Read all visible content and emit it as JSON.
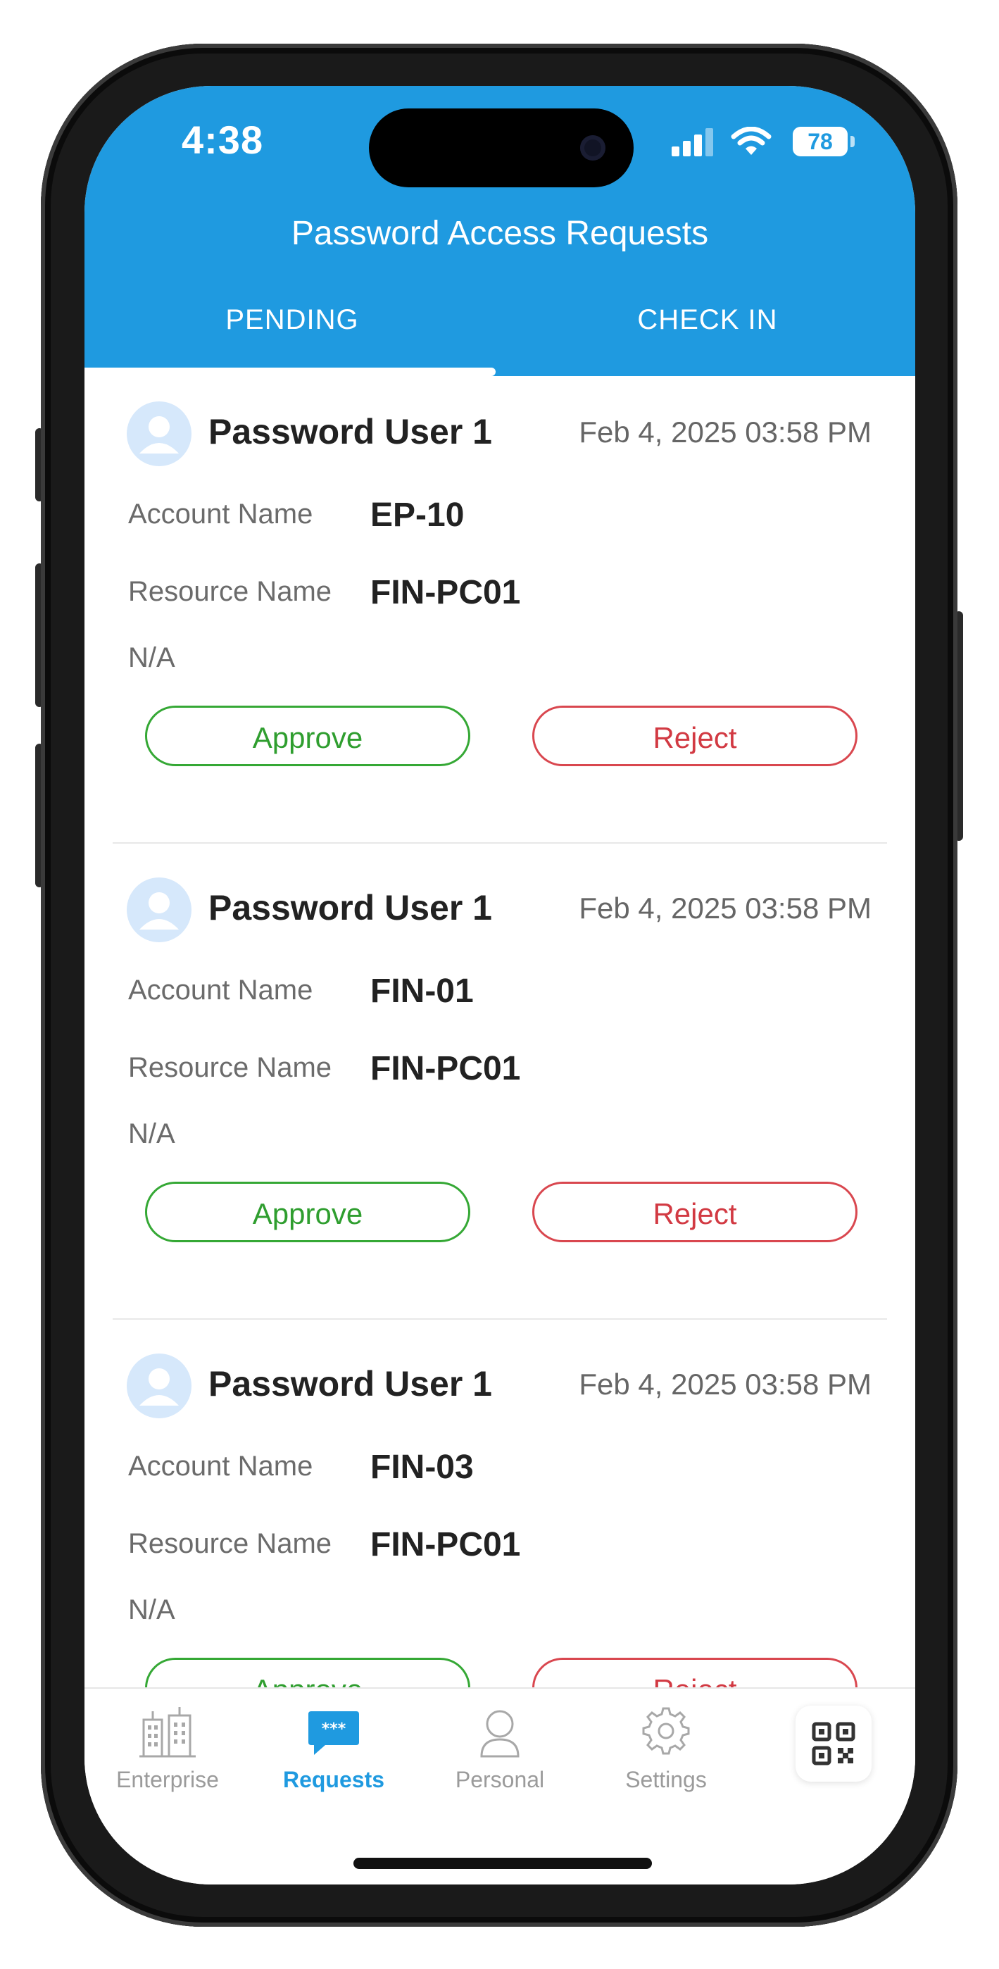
{
  "status_bar": {
    "time": "4:38",
    "battery": "78"
  },
  "header": {
    "title": "Password Access Requests"
  },
  "tabs": [
    {
      "label": "PENDING",
      "active": true
    },
    {
      "label": "CHECK IN",
      "active": false
    }
  ],
  "requests": [
    {
      "user": "Password User 1",
      "time": "Feb 4, 2025 03:58 PM",
      "account_label": "Account Name",
      "account_value": "EP-10",
      "resource_label": "Resource Name",
      "resource_value": "FIN-PC01",
      "note": "N/A",
      "approve_label": "Approve",
      "reject_label": "Reject"
    },
    {
      "user": "Password User 1",
      "time": "Feb 4, 2025 03:58 PM",
      "account_label": "Account Name",
      "account_value": "FIN-01",
      "resource_label": "Resource Name",
      "resource_value": "FIN-PC01",
      "note": "N/A",
      "approve_label": "Approve",
      "reject_label": "Reject"
    },
    {
      "user": "Password User 1",
      "time": "Feb 4, 2025 03:58 PM",
      "account_label": "Account Name",
      "account_value": "FIN-03",
      "resource_label": "Resource Name",
      "resource_value": "FIN-PC01",
      "note": "N/A",
      "approve_label": "Approve",
      "reject_label": "Reject"
    }
  ],
  "bottom_nav": [
    {
      "label": "Enterprise",
      "icon": "buildings-icon",
      "active": false
    },
    {
      "label": "Requests",
      "icon": "chat-bubble-icon",
      "active": true
    },
    {
      "label": "Personal",
      "icon": "person-icon",
      "active": false
    },
    {
      "label": "Settings",
      "icon": "gear-icon",
      "active": false
    }
  ],
  "qr_icon": "qr-code-icon",
  "colors": {
    "primary": "#1f9ae0",
    "approve": "#2f9e2f",
    "reject": "#d23a43"
  }
}
